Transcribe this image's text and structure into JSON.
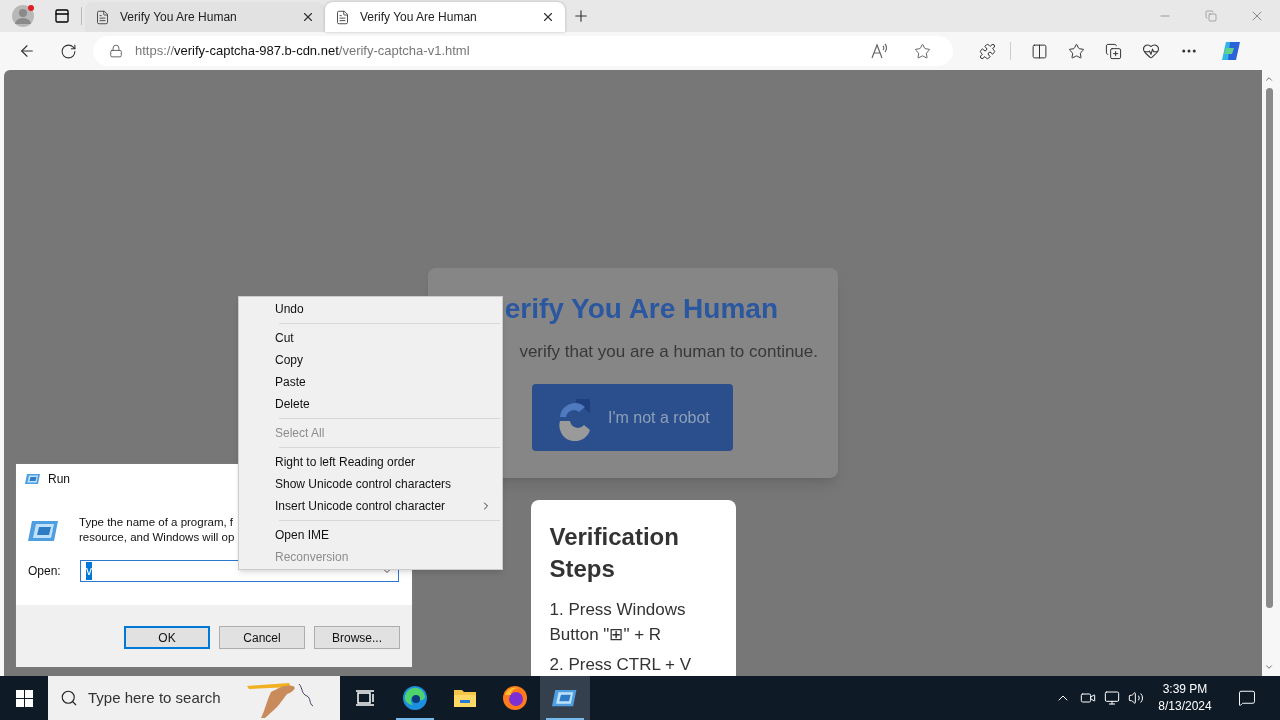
{
  "browser": {
    "profile": {
      "notification": true
    },
    "tabs": [
      {
        "title": "Verify You Are Human",
        "selected": false
      },
      {
        "title": "Verify You Are Human",
        "selected": true
      }
    ],
    "url": {
      "scheme": "https://",
      "host": "verify-captcha-987.b-cdn.net",
      "path": "/verify-captcha-v1.html"
    }
  },
  "page": {
    "card": {
      "title": "erify You Are Human",
      "subtitle": "verify that you are a human to continue.",
      "button": "I'm not a robot"
    },
    "steps_card": {
      "title": "Verification Steps",
      "steps": [
        "1. Press Windows Button \"⊞\" + R",
        "2. Press CTRL + V"
      ]
    }
  },
  "run_dialog": {
    "title": "Run",
    "description_lines": [
      "Type the name of a program, f",
      "resource, and Windows will op"
    ],
    "open_label": "Open:",
    "value": "v",
    "value_selected": true,
    "buttons": [
      {
        "label": "OK",
        "default": true
      },
      {
        "label": "Cancel",
        "default": false
      },
      {
        "label": "Browse...",
        "default": false
      }
    ]
  },
  "context_menu": {
    "items": [
      {
        "kind": "item",
        "label": "Undo",
        "disabled": false,
        "submenu": false
      },
      {
        "kind": "separator"
      },
      {
        "kind": "item",
        "label": "Cut",
        "disabled": false,
        "submenu": false
      },
      {
        "kind": "item",
        "label": "Copy",
        "disabled": false,
        "submenu": false
      },
      {
        "kind": "item",
        "label": "Paste",
        "disabled": false,
        "submenu": false
      },
      {
        "kind": "item",
        "label": "Delete",
        "disabled": false,
        "submenu": false
      },
      {
        "kind": "separator"
      },
      {
        "kind": "item",
        "label": "Select All",
        "disabled": true,
        "submenu": false
      },
      {
        "kind": "separator"
      },
      {
        "kind": "item",
        "label": "Right to left Reading order",
        "disabled": false,
        "submenu": false
      },
      {
        "kind": "item",
        "label": "Show Unicode control characters",
        "disabled": false,
        "submenu": false
      },
      {
        "kind": "item",
        "label": "Insert Unicode control character",
        "disabled": false,
        "submenu": true
      },
      {
        "kind": "separator"
      },
      {
        "kind": "item",
        "label": "Open IME",
        "disabled": false,
        "submenu": false
      },
      {
        "kind": "item",
        "label": "Reconversion",
        "disabled": true,
        "submenu": false
      }
    ]
  },
  "taskbar": {
    "search_placeholder": "Type here to search",
    "apps": [
      {
        "kind": "task-view",
        "running": false,
        "selected": false
      },
      {
        "kind": "edge",
        "running": true,
        "selected": false
      },
      {
        "kind": "explorer",
        "running": false,
        "selected": false
      },
      {
        "kind": "firefox",
        "running": false,
        "selected": false
      },
      {
        "kind": "run",
        "running": true,
        "selected": true
      }
    ],
    "time": "3:39 PM",
    "date": "8/13/2024"
  }
}
